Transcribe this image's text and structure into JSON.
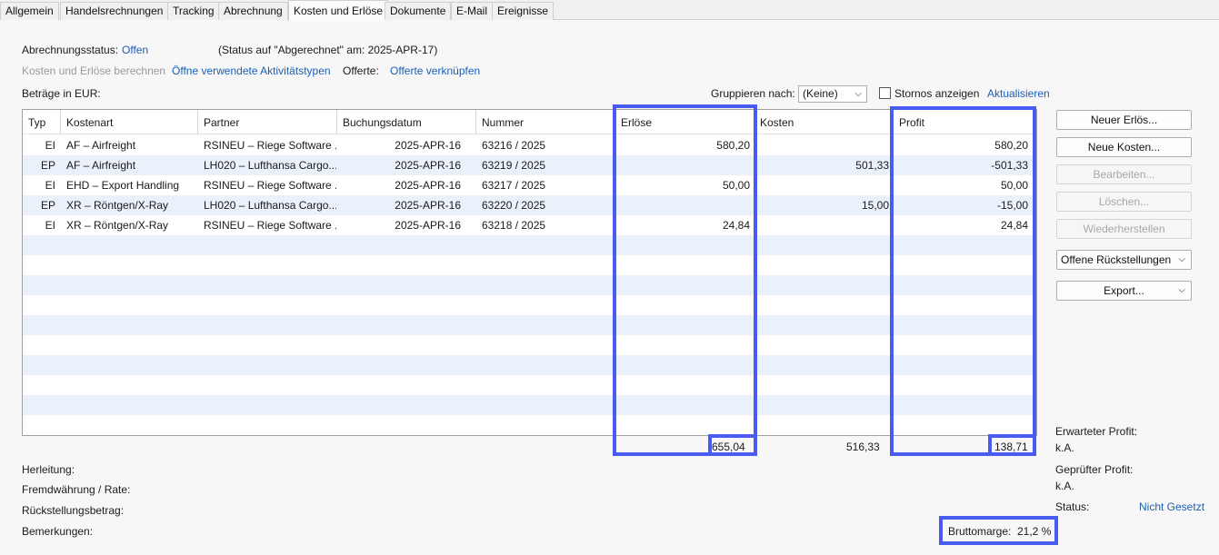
{
  "tabs": [
    "Allgemein",
    "Handelsrechnungen",
    "Tracking",
    "Abrechnung",
    "Kosten und Erlöse",
    "Dokumente",
    "E-Mail",
    "Ereignisse"
  ],
  "status": {
    "label": "Abrechnungsstatus:",
    "value": "Offen",
    "note": "(Status auf \"Abgerechnet\" am: 2025-APR-17)"
  },
  "actions": {
    "calc": "Kosten und Erlöse berechnen",
    "activities": "Öffne verwendete Aktivitätstypen",
    "offer_label": "Offerte:",
    "offer_link": "Offerte verknüpfen"
  },
  "amounts_label": "Beträge in EUR:",
  "group": {
    "label": "Gruppieren nach:",
    "value": "(Keine)",
    "storno_label": "Stornos anzeigen",
    "refresh": "Aktualisieren"
  },
  "columns": [
    "Typ",
    "Kostenart",
    "Partner",
    "Buchungsdatum",
    "Nummer",
    "Erlöse",
    "Kosten",
    "Profit"
  ],
  "rows": [
    {
      "typ": "EI",
      "kostenart": "AF – Airfreight",
      "partner": "RSINEU – Riege Software ...",
      "datum": "2025-APR-16",
      "nummer": "63216 / 2025",
      "erloese": "580,20",
      "kosten": "",
      "profit": "580,20"
    },
    {
      "typ": "EP",
      "kostenart": "AF – Airfreight",
      "partner": "LH020 – Lufthansa Cargo...",
      "datum": "2025-APR-16",
      "nummer": "63219 / 2025",
      "erloese": "",
      "kosten": "501,33",
      "profit": "-501,33"
    },
    {
      "typ": "EI",
      "kostenart": "EHD – Export Handling",
      "partner": "RSINEU – Riege Software ...",
      "datum": "2025-APR-16",
      "nummer": "63217 / 2025",
      "erloese": "50,00",
      "kosten": "",
      "profit": "50,00"
    },
    {
      "typ": "EP",
      "kostenart": "XR – Röntgen/X-Ray",
      "partner": "LH020 – Lufthansa Cargo...",
      "datum": "2025-APR-16",
      "nummer": "63220 / 2025",
      "erloese": "",
      "kosten": "15,00",
      "profit": "-15,00"
    },
    {
      "typ": "EI",
      "kostenart": "XR – Röntgen/X-Ray",
      "partner": "RSINEU – Riege Software ...",
      "datum": "2025-APR-16",
      "nummer": "63218 / 2025",
      "erloese": "24,84",
      "kosten": "",
      "profit": "24,84"
    }
  ],
  "totals": {
    "erloese": "655,04",
    "kosten": "516,33",
    "profit": "138,71"
  },
  "buttons": {
    "new_revenue": "Neuer Erlös...",
    "new_costs": "Neue Kosten...",
    "edit": "Bearbeiten...",
    "delete": "Löschen...",
    "restore": "Wiederherstellen",
    "provisions": "Offene Rückstellungen",
    "export": "Export..."
  },
  "footer": {
    "herleitung": "Herleitung:",
    "fremdwaehrung": "Fremdwährung / Rate:",
    "rueckstellung": "Rückstellungsbetrag:",
    "bemerkungen": "Bemerkungen:",
    "bruttomarge_label": "Bruttomarge:",
    "bruttomarge_value": "21,2 %"
  },
  "profit_info": {
    "expected_label": "Erwarteter Profit:",
    "expected_value": "k.A.",
    "checked_label": "Geprüfter Profit:",
    "checked_value": "k.A.",
    "status_label": "Status:",
    "status_value": "Nicht Gesetzt"
  },
  "colors": {
    "highlight": "#4a5cf0",
    "link": "#1a5fb4",
    "row_alt": "#eaf1fb"
  }
}
